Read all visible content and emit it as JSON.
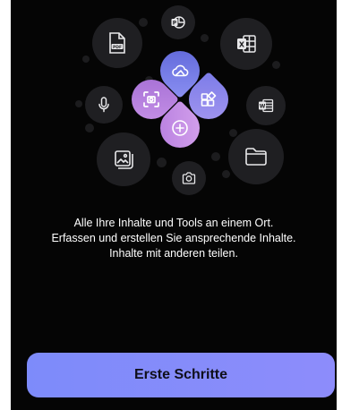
{
  "icons": {
    "pdf": "pdf-file-icon",
    "presentation": "powerpoint-icon",
    "excel": "excel-icon",
    "word": "word-icon",
    "microphone": "microphone-icon",
    "image": "image-icon",
    "folder": "folder-icon",
    "camera": "camera-icon",
    "cloud": "cloud-icon",
    "scan": "scan-icon",
    "apps": "apps-icon",
    "add": "add-icon"
  },
  "colors": {
    "background": "#050505",
    "bubble": "#1f1f22",
    "petal_top": "#6f78e8",
    "petal_left": "#b57bdc",
    "petal_right": "#9088ee",
    "petal_bottom": "#c68ee0",
    "button": "#8089fa"
  },
  "message": {
    "line1": "Alle Ihre Inhalte und Tools an einem Ort.",
    "line2": "Erfassen und erstellen Sie ansprechende Inhalte.",
    "line3": "Inhalte mit anderen teilen."
  },
  "cta": {
    "label": "Erste Schritte"
  }
}
